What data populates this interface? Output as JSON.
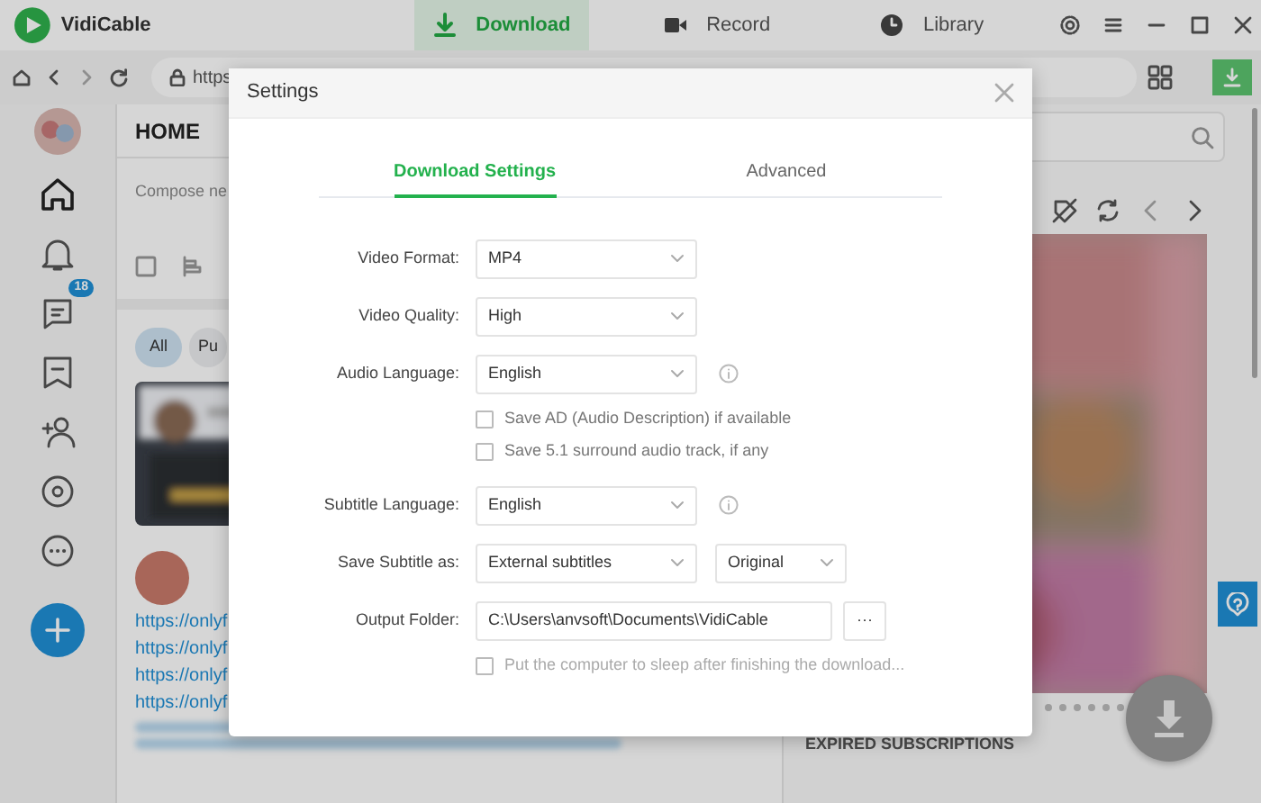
{
  "app": {
    "name": "VidiCable"
  },
  "top_tabs": [
    {
      "label": "Download",
      "selected": true,
      "kind": "download"
    },
    {
      "label": "Record",
      "selected": false,
      "kind": "record"
    },
    {
      "label": "Library",
      "selected": false,
      "kind": "library"
    }
  ],
  "address_bar": {
    "value": "https"
  },
  "sidebar": {
    "message_badge": "18"
  },
  "home": {
    "title": "HOME",
    "compose_placeholder": "Compose ne",
    "filters": [
      {
        "label": "All",
        "selected": true
      },
      {
        "label": "Pu",
        "selected": false
      }
    ],
    "links": [
      "https://onlyf",
      "https://onlyf",
      "https://onlyf",
      "https://onlyf"
    ]
  },
  "right_panel": {
    "section_title": "EXPIRED SUBSCRIPTIONS"
  },
  "dialog": {
    "title": "Settings",
    "tabs": [
      {
        "label": "Download Settings",
        "selected": true
      },
      {
        "label": "Advanced",
        "selected": false
      }
    ],
    "settings": [
      {
        "kind": "select",
        "label": "Video Format:",
        "value": "MP4"
      },
      {
        "kind": "select",
        "label": "Video Quality:",
        "value": "High"
      },
      {
        "kind": "select",
        "label": "Audio Language:",
        "value": "English",
        "info": true
      },
      {
        "kind": "checkbox",
        "label": "Save AD (Audio Description) if available",
        "checked": false
      },
      {
        "kind": "checkbox",
        "label": "Save 5.1 surround audio track, if any",
        "checked": false
      },
      {
        "kind": "select",
        "label": "Subtitle Language:",
        "value": "English",
        "info": true
      },
      {
        "kind": "select2",
        "label": "Save Subtitle as:",
        "value": "External subtitles",
        "value2": "Original"
      },
      {
        "kind": "folder",
        "label": "Output Folder:",
        "value": "C:\\Users\\anvsoft\\Documents\\VidiCable",
        "button": "···"
      },
      {
        "kind": "checkbox",
        "label": "Put the computer to sleep after finishing the download...",
        "checked": false
      }
    ]
  }
}
